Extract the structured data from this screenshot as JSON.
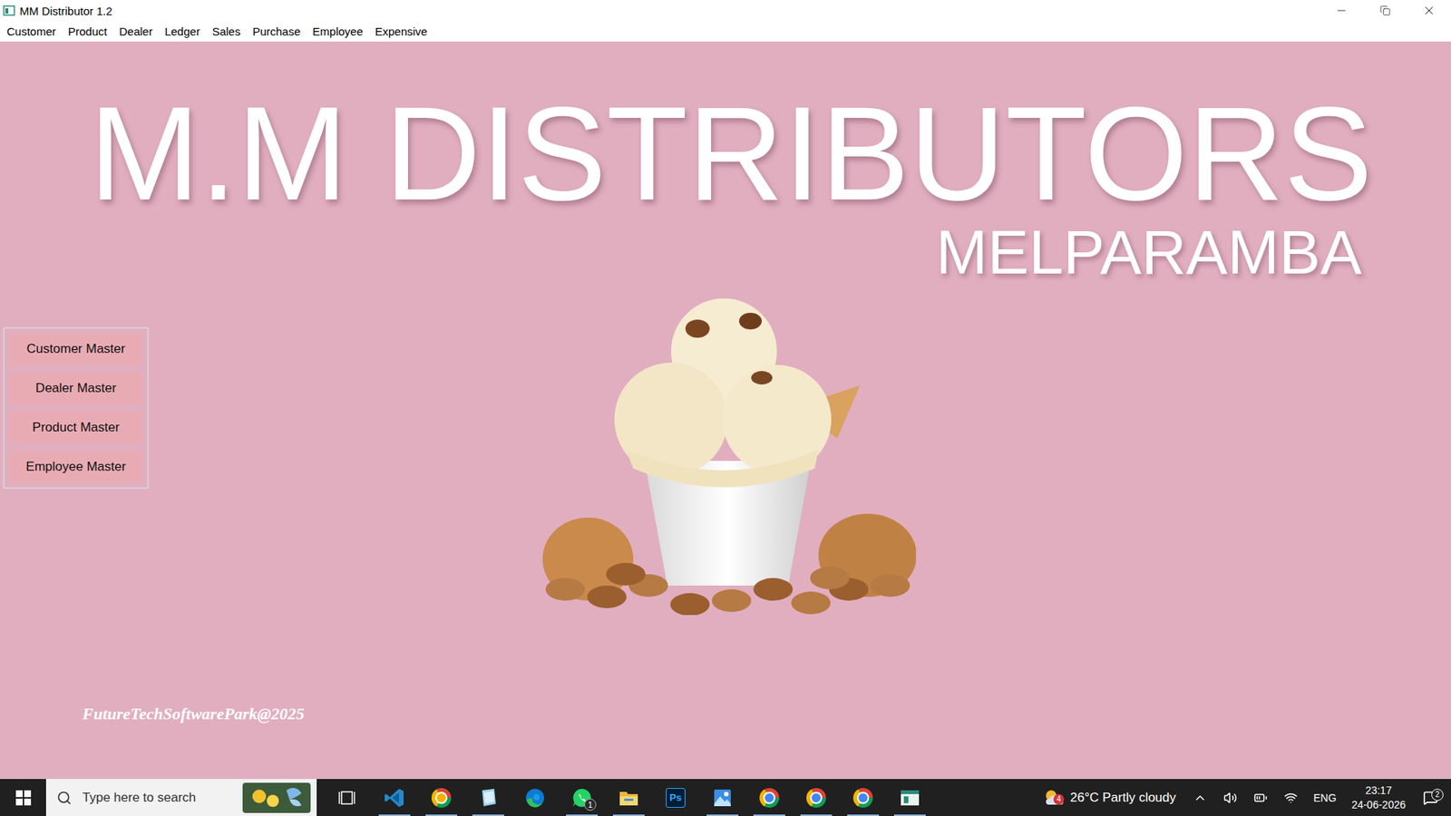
{
  "window": {
    "title": "MM Distributor 1.2"
  },
  "menu": [
    "Customer",
    "Product",
    "Dealer",
    "Ledger",
    "Sales",
    "Purchase",
    "Employee",
    "Expensive"
  ],
  "header": {
    "title": "M.M DISTRIBUTORS",
    "subtitle": "MELPARAMBA"
  },
  "sidebar": {
    "items": [
      "Customer Master",
      "Dealer Master",
      "Product Master",
      "Employee Master"
    ]
  },
  "footer": "FutureTechSoftwarePark@2025",
  "taskbar": {
    "search": {
      "placeholder": "Type here to search"
    },
    "apps": [
      {
        "kind": "task-view",
        "running": false
      },
      {
        "kind": "vscode",
        "running": true
      },
      {
        "kind": "chrome-dev",
        "running": true
      },
      {
        "kind": "notes",
        "running": true
      },
      {
        "kind": "edge",
        "running": false
      },
      {
        "kind": "whatsapp",
        "running": true,
        "badge": "1"
      },
      {
        "kind": "explorer",
        "running": true
      },
      {
        "kind": "photoshop",
        "running": false,
        "label": "Ps"
      },
      {
        "kind": "photos",
        "running": true
      },
      {
        "kind": "chrome",
        "running": true
      },
      {
        "kind": "chrome",
        "running": true
      },
      {
        "kind": "chrome",
        "running": true
      },
      {
        "kind": "app",
        "running": true
      }
    ],
    "weather": {
      "text": "26°C Partly cloudy",
      "badge": "4"
    },
    "language": "ENG",
    "time": "23:17",
    "date": "24-06-2026",
    "notifications": "2"
  }
}
